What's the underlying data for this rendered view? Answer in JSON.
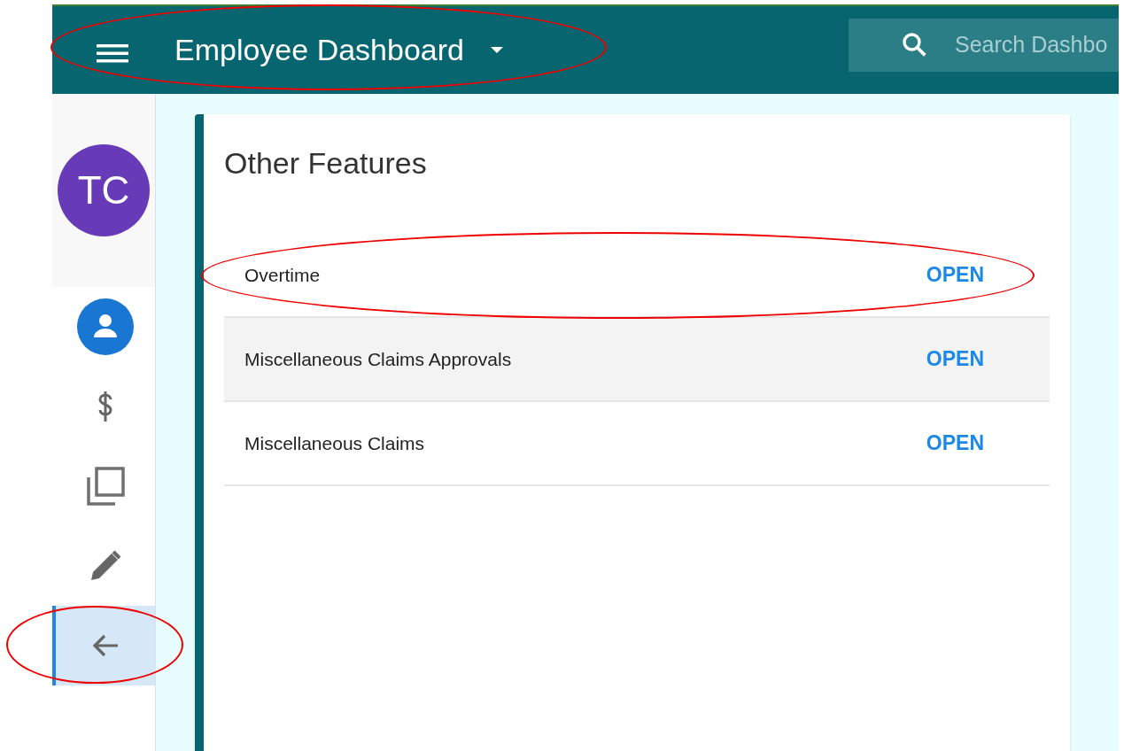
{
  "header": {
    "title": "Employee Dashboard",
    "circled": true,
    "search": {
      "placeholder": "Search Dashbo"
    }
  },
  "sidebar": {
    "avatar": {
      "initials": "TC"
    },
    "items": [
      {
        "kind": "person",
        "selected": false,
        "circled": false
      },
      {
        "kind": "dollar",
        "selected": false,
        "circled": false
      },
      {
        "kind": "copy",
        "selected": false,
        "circled": false
      },
      {
        "kind": "pencil",
        "selected": false,
        "circled": false
      },
      {
        "kind": "back",
        "selected": true,
        "circled": true
      }
    ]
  },
  "card": {
    "title": "Other Features",
    "rows": [
      {
        "label": "Overtime",
        "action": "OPEN",
        "hovered": false,
        "circled": true
      },
      {
        "label": "Miscellaneous Claims Approvals",
        "action": "OPEN",
        "hovered": true,
        "circled": false
      },
      {
        "label": "Miscellaneous Claims",
        "action": "OPEN",
        "hovered": false,
        "circled": false
      }
    ]
  }
}
